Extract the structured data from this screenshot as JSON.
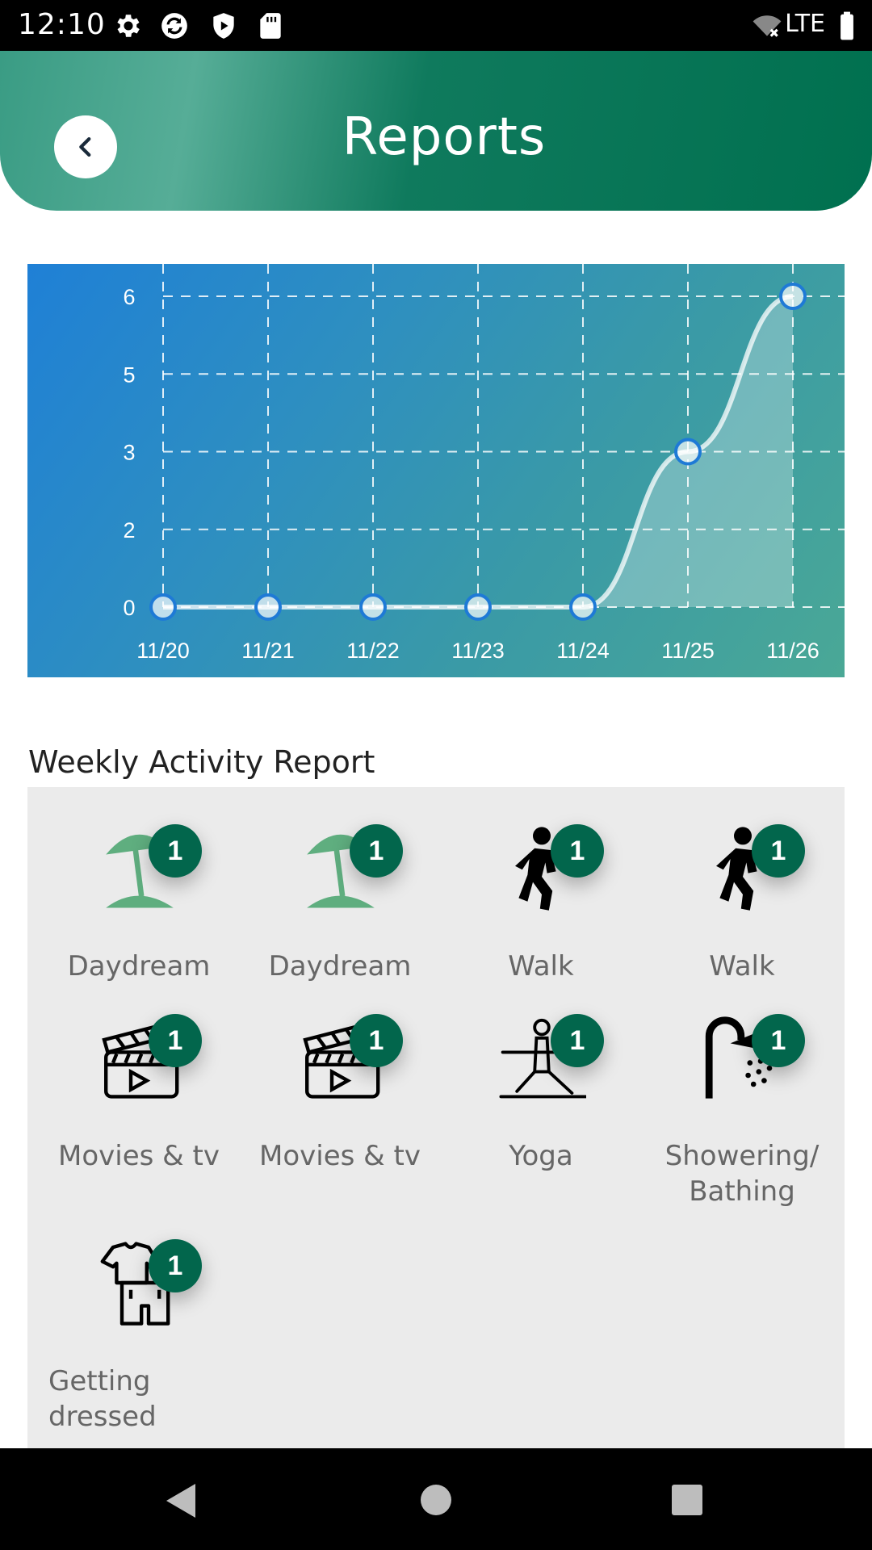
{
  "status_bar": {
    "time": "12:10",
    "network": "LTE",
    "icons": [
      "gear-icon",
      "sync-icon",
      "shield-icon",
      "sd-card-icon",
      "wifi-off-icon",
      "battery-icon"
    ]
  },
  "header": {
    "title": "Reports",
    "back_icon": "chevron-left-icon",
    "colors": {
      "gradient_start": "#3a9c84",
      "gradient_end": "#00704f"
    }
  },
  "chart_data": {
    "type": "area",
    "categories": [
      "11/20",
      "11/21",
      "11/22",
      "11/23",
      "11/24",
      "11/25",
      "11/26"
    ],
    "series": [
      {
        "values": [
          0,
          0,
          0,
          0,
          0,
          3,
          6
        ]
      }
    ],
    "yticks": [
      "6",
      "5",
      "3",
      "2",
      "0"
    ],
    "ylim": [
      0,
      6
    ],
    "grid": true,
    "colors": {
      "bg_start": "#1f80d6",
      "bg_end": "#4aa896",
      "marker_stroke": "#1e7ad6"
    }
  },
  "report": {
    "title": "Weekly Activity Report",
    "items": [
      {
        "label": "Daydream",
        "count": "1",
        "icon": "beach-umbrella-icon"
      },
      {
        "label": "Daydream",
        "count": "1",
        "icon": "beach-umbrella-icon"
      },
      {
        "label": "Walk",
        "count": "1",
        "icon": "walking-person-icon"
      },
      {
        "label": "Walk",
        "count": "1",
        "icon": "walking-person-icon"
      },
      {
        "label": "Movies & tv",
        "count": "1",
        "icon": "clapperboard-icon"
      },
      {
        "label": "Movies & tv",
        "count": "1",
        "icon": "clapperboard-icon"
      },
      {
        "label": "Yoga",
        "count": "1",
        "icon": "yoga-pose-icon"
      },
      {
        "label": "Showering/ Bathing",
        "count": "1",
        "icon": "shower-icon"
      },
      {
        "label": "Getting dressed",
        "count": "1",
        "icon": "clothes-icon"
      }
    ],
    "badge_color": "#02664c"
  }
}
